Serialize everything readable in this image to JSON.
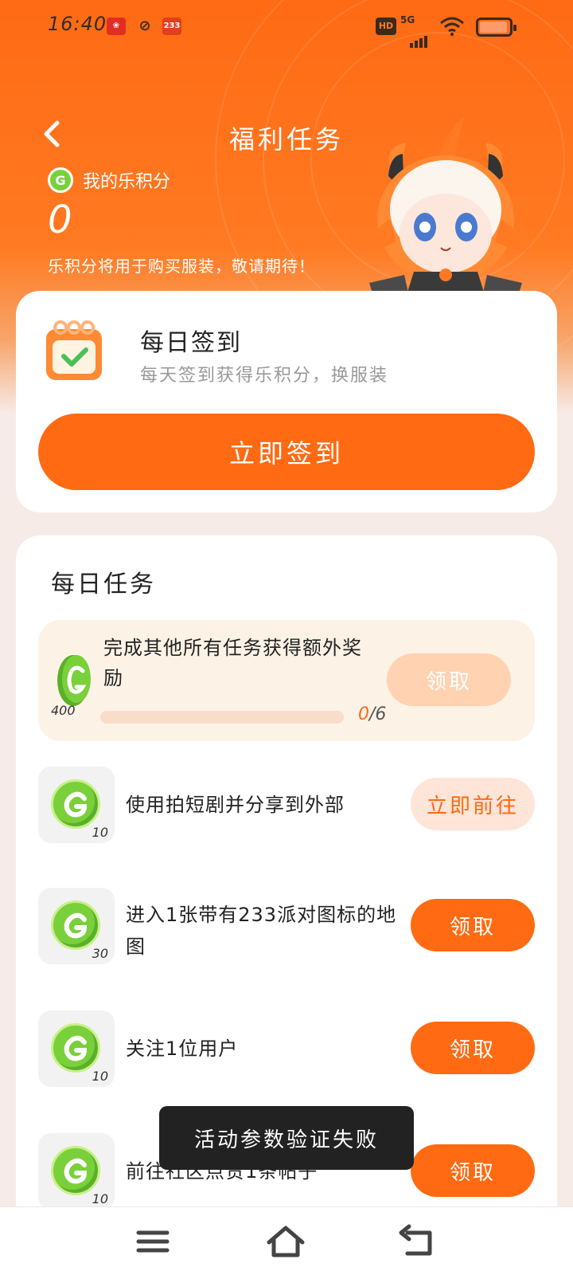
{
  "status_bar": {
    "time": "16:40",
    "app_icons": [
      "pinduoduo-icon",
      "swirl-app-icon",
      "app-233-icon"
    ],
    "app_233_label": "233",
    "hd_label": "HD",
    "network": "5G",
    "battery": "charging"
  },
  "header": {
    "title": "福利任务",
    "points_label": "我的乐积分",
    "points_value": "0",
    "note": "乐积分将用于购买服装，敬请期待！"
  },
  "signin": {
    "title": "每日签到",
    "subtitle": "每天签到获得乐积分，换服装",
    "button": "立即签到"
  },
  "tasks": {
    "title": "每日任务",
    "bonus": {
      "text": "完成其他所有任务获得额外奖励",
      "coin_amount": "400",
      "progress_current": "0",
      "progress_total": "6",
      "progress_fraction": 0,
      "button": "领取"
    },
    "items": [
      {
        "text": "使用拍短剧并分享到外部",
        "amount": "10",
        "button": "立即前往",
        "state": "go"
      },
      {
        "text": "进入1张带有233派对图标的地图",
        "amount": "30",
        "button": "领取",
        "state": "claim"
      },
      {
        "text": "关注1位用户",
        "amount": "10",
        "button": "领取",
        "state": "claim"
      },
      {
        "text": "前往社区点赞1条帖子",
        "amount": "10",
        "button": "领取",
        "state": "claim"
      }
    ]
  },
  "toast": {
    "text": "活动参数验证失败"
  },
  "colors": {
    "accent": "#ff6a12",
    "coin_green": "#7ad03a",
    "claim_disabled": "#ffd2b2",
    "go_bg": "#ffe4d8"
  },
  "nav": [
    "menu-icon",
    "home-icon",
    "back-icon"
  ]
}
